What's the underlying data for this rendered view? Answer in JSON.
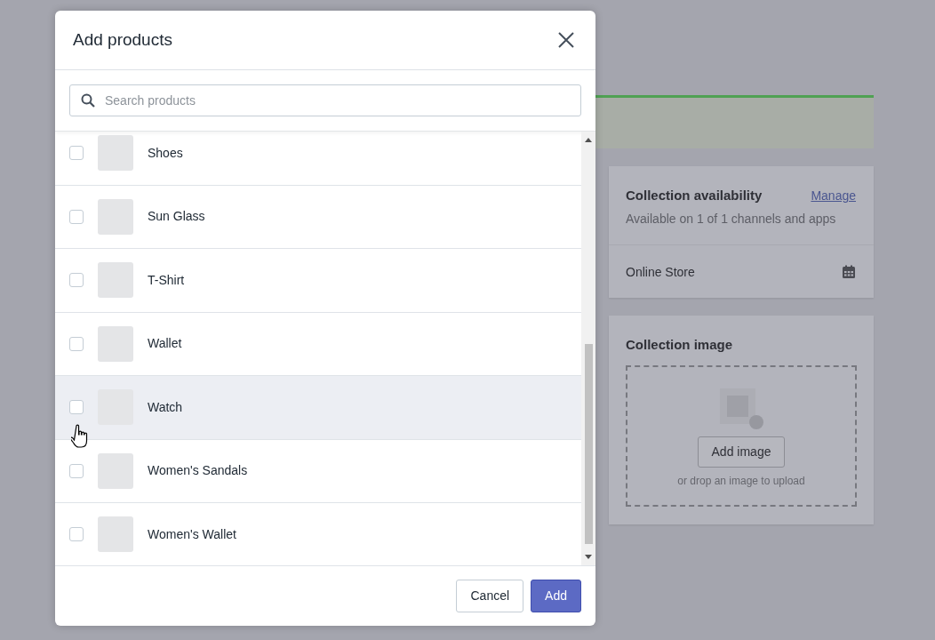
{
  "background": {
    "collection_availability": {
      "title": "Collection availability",
      "action": "Manage",
      "subtitle": "Available on 1 of 1 channels and apps",
      "channel": "Online Store"
    },
    "collection_image": {
      "title": "Collection image",
      "button": "Add image",
      "hint": "or drop an image to upload"
    }
  },
  "modal": {
    "title": "Add products",
    "search": {
      "placeholder": "Search products"
    },
    "products": [
      {
        "name": "Shoes",
        "checked": false,
        "highlighted": false
      },
      {
        "name": "Sun Glass",
        "checked": false,
        "highlighted": false
      },
      {
        "name": "T-Shirt",
        "checked": false,
        "highlighted": false
      },
      {
        "name": "Wallet",
        "checked": false,
        "highlighted": false
      },
      {
        "name": "Watch",
        "checked": false,
        "highlighted": true
      },
      {
        "name": "Women's Sandals",
        "checked": false,
        "highlighted": false
      },
      {
        "name": "Women's Wallet",
        "checked": false,
        "highlighted": false
      }
    ],
    "buttons": [
      {
        "label": "Cancel",
        "kind": "secondary"
      },
      {
        "label": "Add",
        "kind": "primary"
      }
    ]
  }
}
